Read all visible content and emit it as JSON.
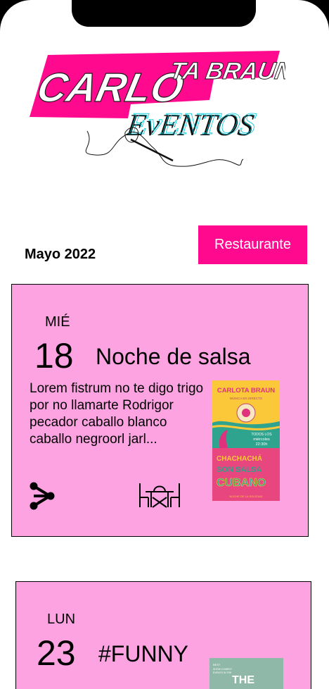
{
  "logo": {
    "line1": "CARLOTA BRAUN",
    "line2": "EVENTOS"
  },
  "header": {
    "month": "Mayo 2022",
    "restaurant_button": "Restaurante"
  },
  "events": [
    {
      "weekday": "MIÉ",
      "day": "18",
      "title": "Noche de salsa",
      "description": "Lorem fistrum no te digo trigo por no llamarte Rodrigor pecador caballo blanco caballo negroorl jarl...",
      "poster": {
        "brand": "CARLOTA BRAUN",
        "subtitle": "MÚSICA EN DIRECTO",
        "date": "TODOS LOS miércoles 22:30h",
        "headline1": "CHACHACHÁ",
        "headline2": "SON  SALSA",
        "headline3": "CUBANO",
        "footer": "NOCHE DE LA SOLEDAD"
      },
      "icons": [
        "share-icon",
        "table-reservation-icon"
      ]
    },
    {
      "weekday": "LUN",
      "day": "23",
      "title": "#FUNNY",
      "poster": {
        "headline": "THE"
      }
    }
  ],
  "colors": {
    "accent": "#ff0a8f",
    "card_bg": "#fda3e2",
    "poster1_bg": "#fbc83a",
    "poster2_bg": "#8fb8a8"
  }
}
